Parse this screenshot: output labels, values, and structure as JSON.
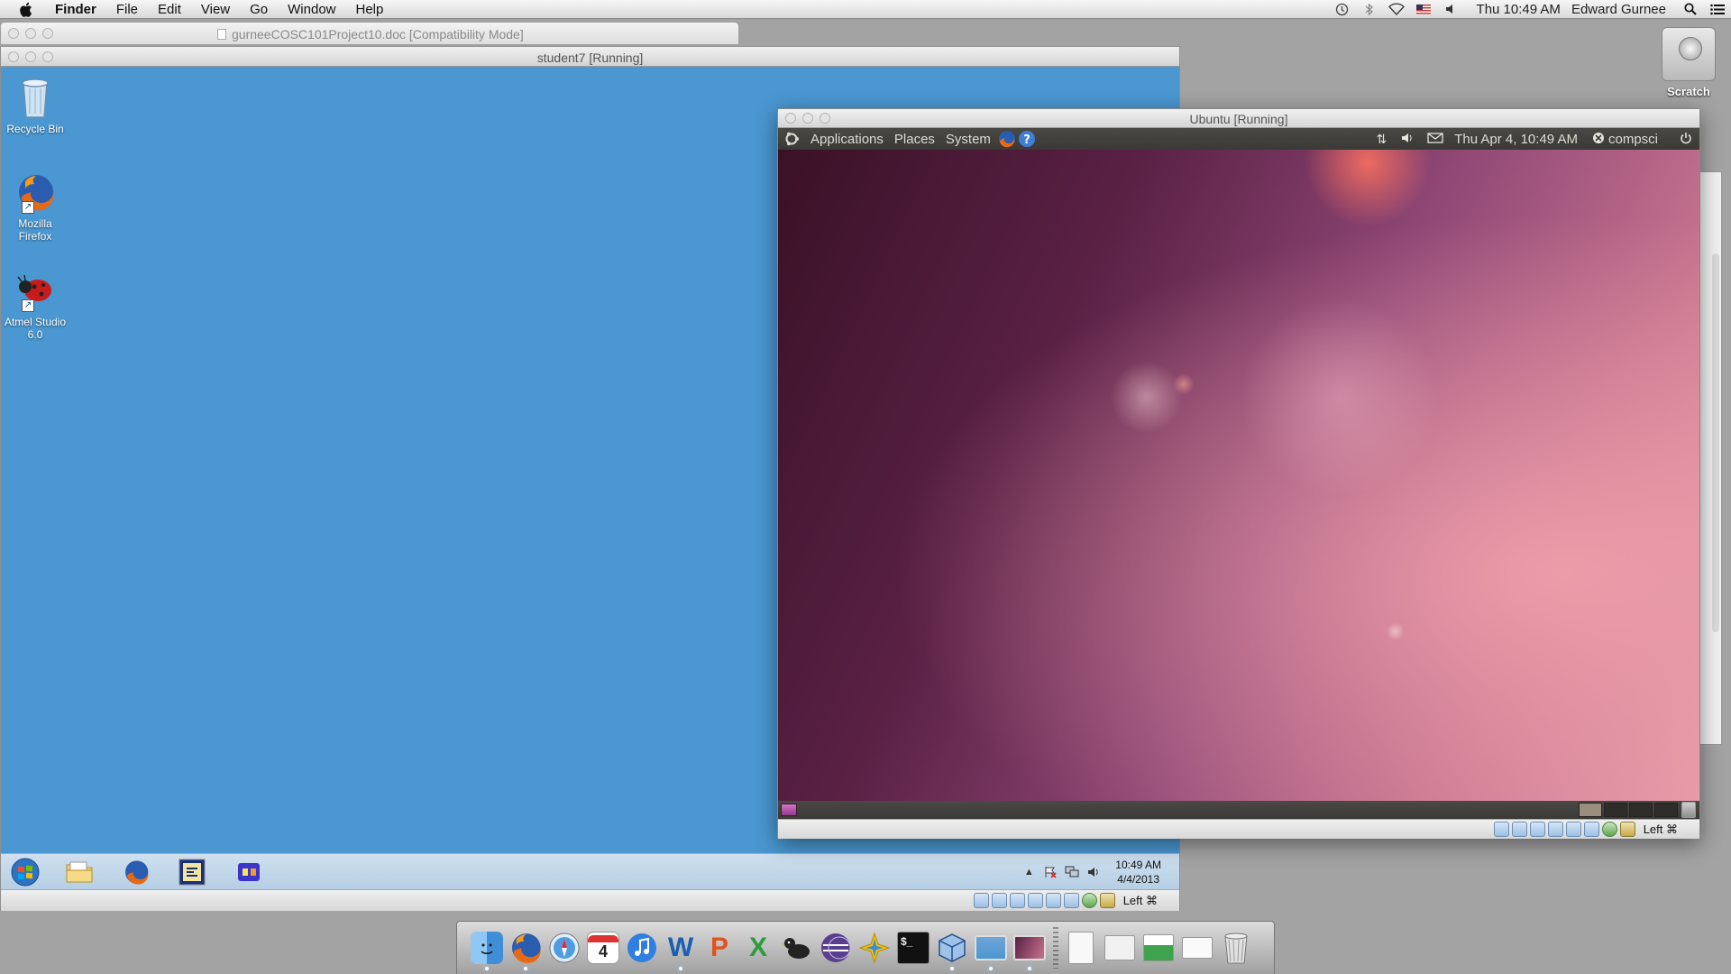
{
  "menubar": {
    "app_name": "Finder",
    "menus": [
      "File",
      "Edit",
      "View",
      "Go",
      "Window",
      "Help"
    ],
    "clock": "Thu 10:49 AM",
    "user": "Edward Gurnee"
  },
  "mac_desktop": {
    "drive_label": "Scratch"
  },
  "word_window": {
    "title": "gurneeCOSC101Project10.doc [Compatibility Mode]"
  },
  "student_window": {
    "title": "student7 [Running]",
    "desktop_icons": [
      {
        "label": "Recycle Bin",
        "icon": "recycle-bin-icon"
      },
      {
        "label": "Mozilla Firefox",
        "icon": "firefox-icon"
      },
      {
        "label": "Atmel Studio 6.0",
        "icon": "atmel-studio-icon"
      }
    ],
    "taskbar": {
      "time": "10:49 AM",
      "date": "4/4/2013"
    },
    "host_key": "Left ⌘"
  },
  "ubuntu_window": {
    "title": "Ubuntu [Running]",
    "panel": {
      "menus": [
        "Applications",
        "Places",
        "System"
      ],
      "datetime": "Thu Apr  4, 10:49 AM",
      "user": "compsci"
    },
    "host_key": "Left ⌘"
  },
  "colors": {
    "windows_desktop": "#4a97d1",
    "ubuntu_panel": "#3f3e3a",
    "mac_desktop": "#a3a3a3"
  },
  "dock": {
    "items": [
      "finder",
      "firefox",
      "safari",
      "calendar",
      "itunes",
      "word",
      "powerpoint",
      "excel",
      "cyberduck",
      "eclipse",
      "mathematica",
      "terminal",
      "virtualbox",
      "student7-vm",
      "ubuntu-vm",
      "documents",
      "downloads",
      "preview",
      "mail",
      "trash"
    ],
    "calendar_day": "4"
  }
}
